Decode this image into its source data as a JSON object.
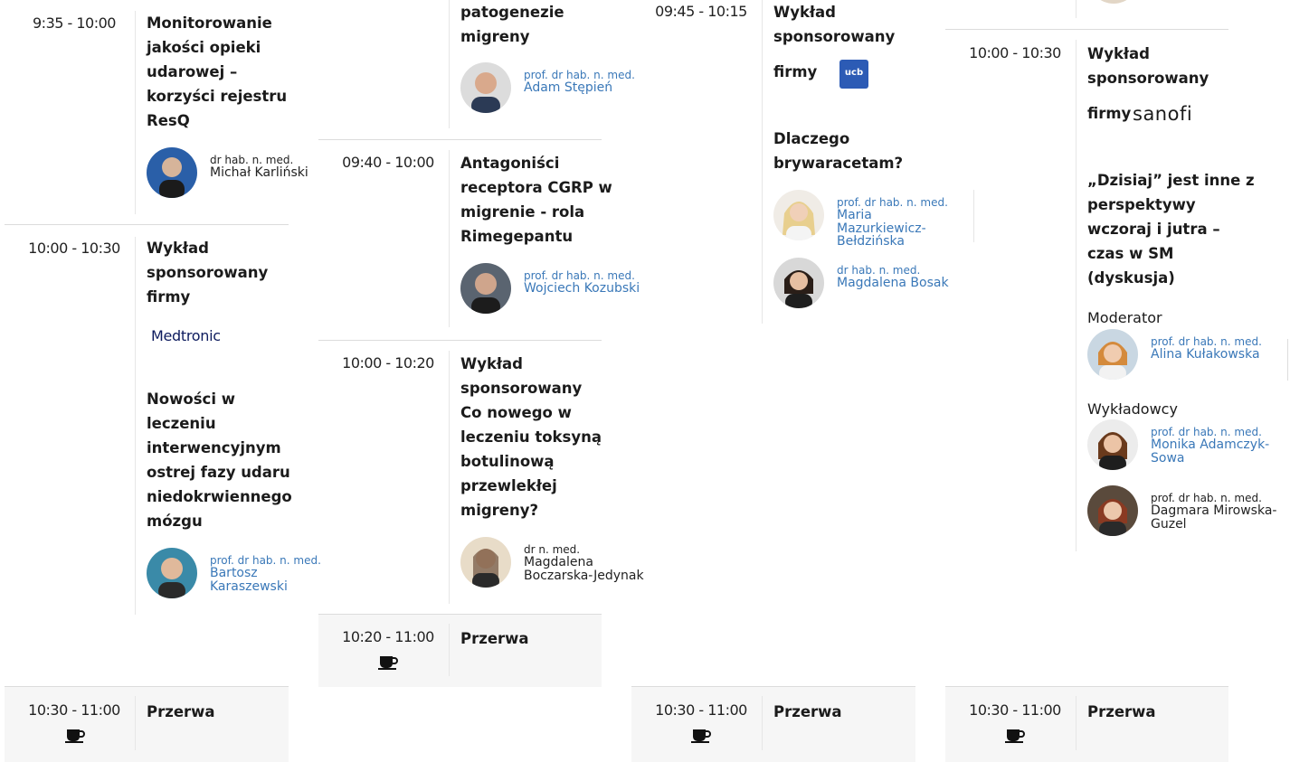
{
  "columns": [
    {
      "sessions": [
        {
          "time": "9:35 - 10:00",
          "title_lines": [
            "Monitorowanie",
            "jakości opieki",
            "udarowej –",
            "korzyści rejestru",
            "ResQ"
          ],
          "speakers": [
            {
              "degree": "dr hab. n. med.",
              "name_lines": [
                "Michał Karliński"
              ]
            }
          ]
        },
        {
          "time": "10:00 - 10:30",
          "title_lines": [
            "Wykład",
            "sponsorowany",
            "firmy"
          ],
          "sponsor": "Medtronic",
          "title2_lines": [
            "Nowości w",
            "leczeniu",
            "interwencyjnym",
            "ostrej fazy udaru",
            "niedokrwiennego",
            "mózgu"
          ],
          "speakers": [
            {
              "degree": "prof. dr hab. n. med.",
              "name_lines": [
                "Bartosz",
                "Karaszewski"
              ]
            }
          ]
        },
        {
          "time": "10:30 - 11:00",
          "title": "Przerwa",
          "icon": "coffee-cup-icon"
        }
      ]
    },
    {
      "sessions": [
        {
          "title_lines": [
            "patogenezie",
            "migreny"
          ],
          "speakers": [
            {
              "degree": "prof. dr hab. n. med.",
              "name_lines": [
                "Adam Stępień"
              ]
            }
          ]
        },
        {
          "time": "09:40 - 10:00",
          "title_lines": [
            "Antagoniści",
            "receptora CGRP w",
            "migrenie - rola",
            "Rimegepantu"
          ],
          "speakers": [
            {
              "degree": "prof. dr hab. n. med.",
              "name_lines": [
                "Wojciech Kozubski"
              ]
            }
          ]
        },
        {
          "time": "10:00 - 10:20",
          "title_lines": [
            "Wykład",
            "sponsorowany",
            "Co nowego w",
            "leczeniu toksyną",
            "botulinową",
            "przewlekłej",
            "migreny?"
          ],
          "speakers": [
            {
              "degree": "dr n. med.",
              "name_lines": [
                "Magdalena",
                "Boczarska-Jedynak"
              ]
            }
          ]
        },
        {
          "time": "10:20 - 11:00",
          "title": "Przerwa",
          "icon": "coffee-cup-icon"
        }
      ]
    },
    {
      "sessions": [
        {
          "time": "09:45 - 10:15",
          "title_lines": [
            "Wykład",
            "sponsorowany"
          ],
          "firmy": "firmy",
          "sponsor": "ucb",
          "title2_lines": [
            "Dlaczego",
            "brywaracetam?"
          ],
          "speakers": [
            {
              "degree": "prof. dr hab. n. med.",
              "name_lines": [
                "Maria",
                "Mazurkiewicz-",
                "Bełdzińska"
              ]
            },
            {
              "degree": "dr hab. n. med.",
              "name_lines": [
                "Magdalena Bosak"
              ]
            }
          ]
        },
        {
          "time": "10:30 - 11:00",
          "title": "Przerwa",
          "icon": "coffee-cup-icon"
        }
      ]
    },
    {
      "sessions": [
        {
          "time": "10:00 - 10:30",
          "title_lines": [
            "Wykład",
            "sponsorowany"
          ],
          "firmy": "firmy",
          "sponsor": "sanofi",
          "title2_lines": [
            "„Dzisiaj” jest inne z",
            "perspektywy",
            "wczoraj i jutra –",
            "czas w SM",
            "(dyskusja)"
          ],
          "moderator_label": "Moderator",
          "moderator": {
            "degree": "prof. dr hab. n. med.",
            "name_lines": [
              "Alina Kułakowska"
            ]
          },
          "lecturers_label": "Wykładowcy",
          "speakers": [
            {
              "degree": "prof. dr hab. n. med.",
              "name_lines": [
                "Monika Adamczyk-",
                "Sowa"
              ]
            },
            {
              "degree": "prof. dr hab. n. med.",
              "name_lines": [
                "Dagmara Mirowska-",
                "Guzel"
              ]
            }
          ]
        },
        {
          "time": "10:30 - 11:00",
          "title": "Przerwa",
          "icon": "coffee-cup-icon"
        }
      ]
    }
  ]
}
